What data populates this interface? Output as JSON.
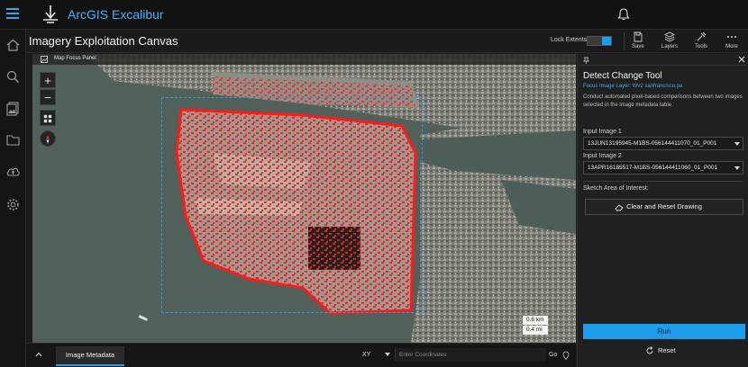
{
  "app": {
    "name": "ArcGIS Excalibur"
  },
  "toolbar": {
    "page_title": "Imagery Exploitation Canvas",
    "lock_extents_label": "Lock Extents",
    "lock_extents_on": true,
    "tools": [
      {
        "label": "Save",
        "icon": "save-icon"
      },
      {
        "label": "Layers",
        "icon": "layers-icon"
      },
      {
        "label": "Tools",
        "icon": "tools-icon"
      },
      {
        "label": "More",
        "icon": "more-icon"
      }
    ]
  },
  "left_rail": {
    "icons": [
      "home-icon",
      "search-icon",
      "imagery-icon",
      "folder-icon",
      "upload-icon",
      "settings-icon"
    ]
  },
  "map": {
    "focus_panel_label": "Map Focus Panel",
    "zoom_in": "+",
    "zoom_out": "−",
    "scale": {
      "km": "0.6 km",
      "mi": "0.4 mi"
    }
  },
  "bottom_bar": {
    "tab_label": "Image Metadata",
    "coord_system": "XY",
    "coord_placeholder": "Enter Coordinates",
    "go_label": "Go"
  },
  "panel": {
    "title": "Detect Change Tool",
    "focus_layer": "Focus Image Layer: Wv2 sanfrancisco.pa",
    "description": "Conduct automated pixel-based comparisons between two images selected in the image metadata table.",
    "input1_label": "Input Image 1",
    "input1_value": "13JUN13195945-M1BS-056144411070_01_P001",
    "input2_label": "Input Image 2",
    "input2_value": "13APR16185517-M1BS-056144411060_01_P001",
    "sketch_label": "Sketch Area of Interest:",
    "clear_label": "Clear and Reset Drawing",
    "run_label": "Run",
    "reset_label": "Reset"
  },
  "colors": {
    "accent": "#1e9dea",
    "change_highlight": "#ff1a1a"
  }
}
